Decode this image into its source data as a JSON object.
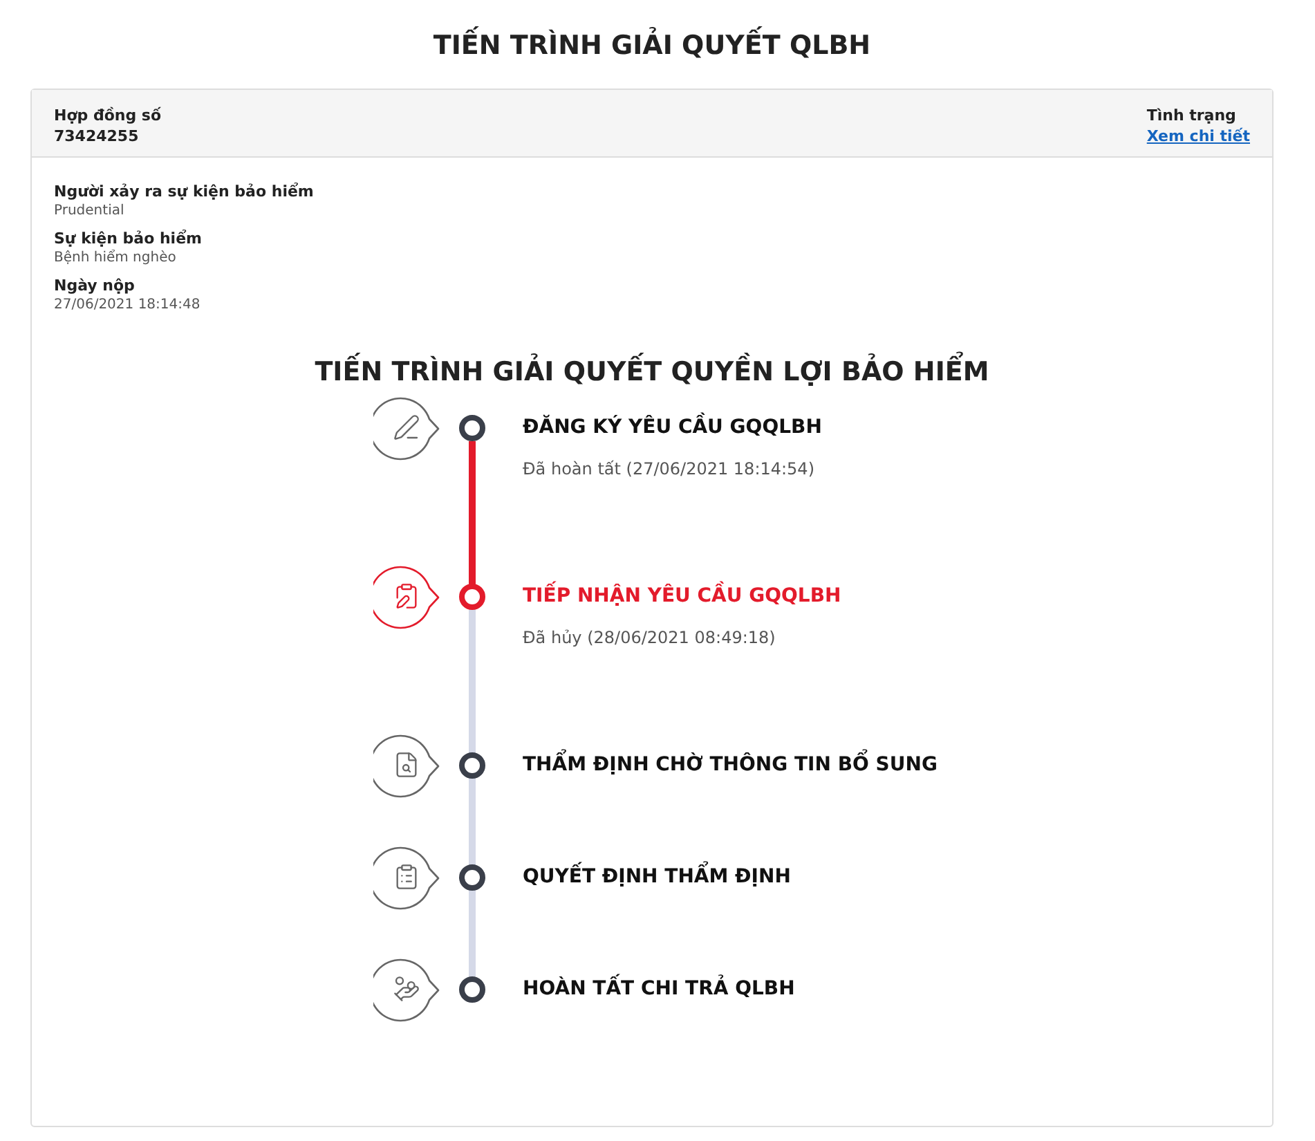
{
  "title": "TIẾN TRÌNH GIẢI QUYẾT QLBH",
  "header": {
    "contract_label": "Hợp đồng số",
    "contract_number": "73424255",
    "status_label": "Tình trạng",
    "status_link": "Xem chi tiết"
  },
  "details": [
    {
      "label": "Người xảy ra sự kiện bảo hiểm",
      "value": "Prudential"
    },
    {
      "label": "Sự kiện bảo hiểm",
      "value": "Bệnh hiểm nghèo"
    },
    {
      "label": "Ngày nộp",
      "value": "27/06/2021 18:14:48"
    }
  ],
  "timeline_title": "TIẾN TRÌNH GIẢI QUYẾT QUYỀN LỢI BẢO HIỂM",
  "progress": {
    "level": 0.27
  },
  "steps": [
    {
      "title": "ĐĂNG KÝ YÊU CẦU GQQLBH",
      "detail": "Đã hoàn tất (27/06/2021 18:14:54)",
      "selected": false
    },
    {
      "title": "TIẾP NHẬN YÊU CẦU GQQLBH",
      "detail": "Đã hủy (28/06/2021 08:49:18)",
      "selected": true
    },
    {
      "title": "THẨM ĐỊNH CHỜ THÔNG TIN BỔ SUNG",
      "selected": false
    },
    {
      "title": "QUYẾT ĐỊNH THẨM ĐỊNH",
      "selected": false
    },
    {
      "title": "HOÀN TẤT CHI TRẢ QLBH",
      "selected": false
    }
  ]
}
